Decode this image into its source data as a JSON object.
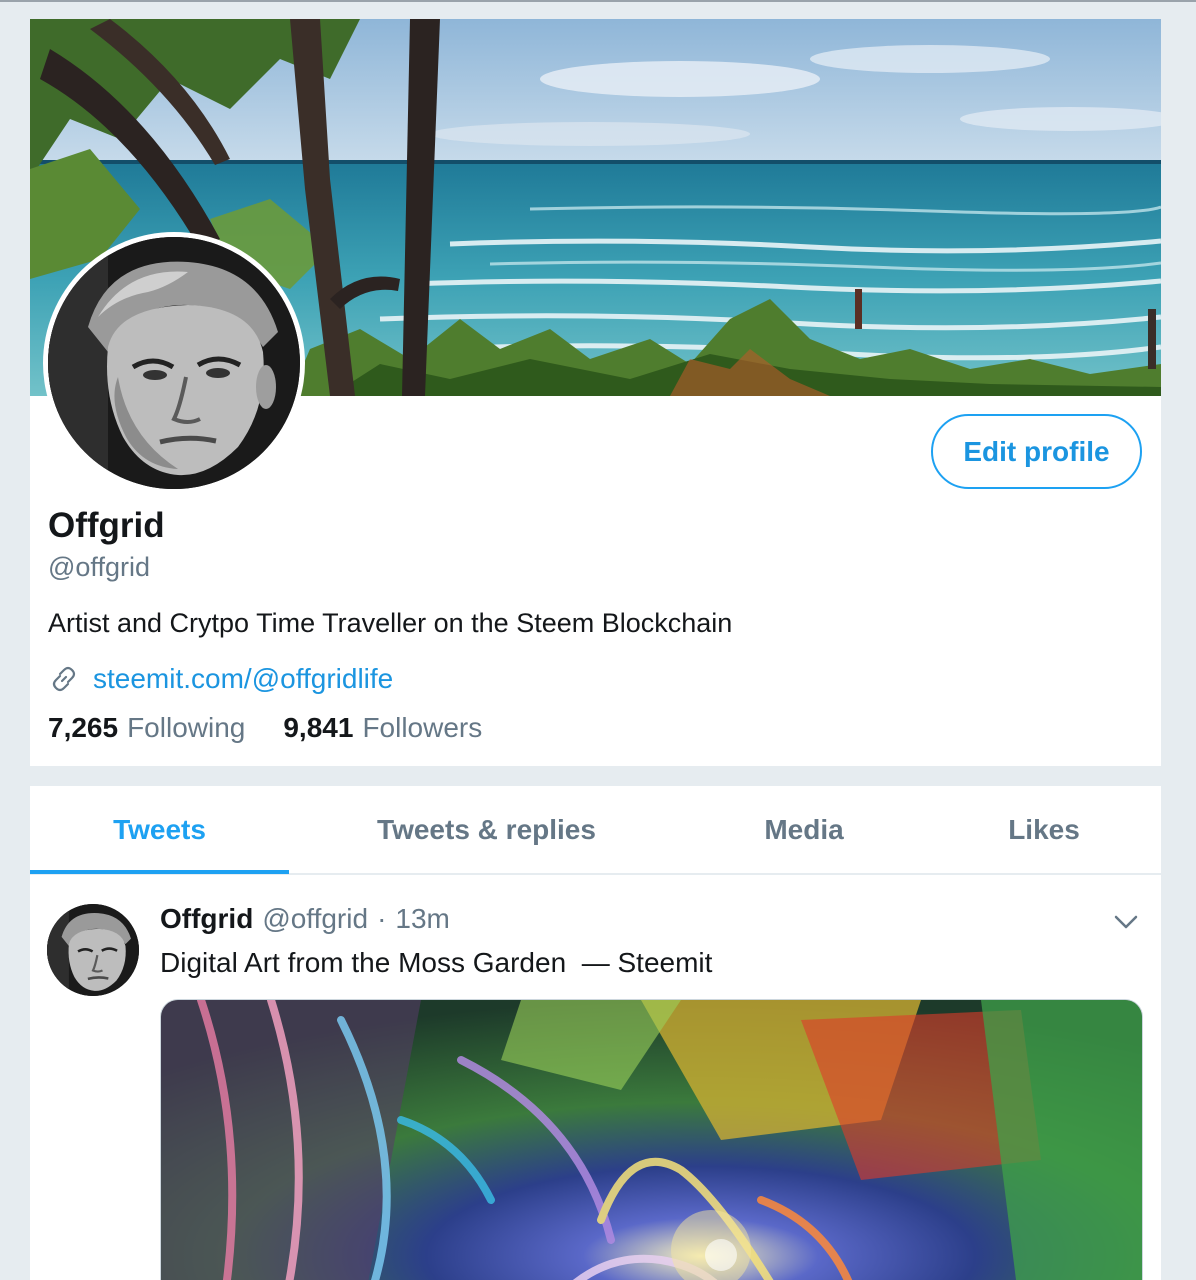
{
  "profile": {
    "display_name": "Offgrid",
    "handle": "@offgrid",
    "bio": "Artist and Crytpo Time Traveller on the Steem Blockchain",
    "website": "steemit.com/@offgridlife",
    "edit_button_label": "Edit profile",
    "following_count": "7,265",
    "following_label": "Following",
    "followers_count": "9,841",
    "followers_label": "Followers",
    "link_icon": "link-icon"
  },
  "tabs": [
    {
      "label": "Tweets",
      "active": true
    },
    {
      "label": "Tweets & replies",
      "active": false
    },
    {
      "label": "Media",
      "active": false
    },
    {
      "label": "Likes",
      "active": false
    }
  ],
  "tweet": {
    "author_name": "Offgrid",
    "author_handle": "@offgrid",
    "separator": "·",
    "time": "13m",
    "text": "Digital Art from the Moss Garden  — Steemit",
    "menu_icon": "chevron-down-icon"
  },
  "colors": {
    "accent": "#1da1f2",
    "link": "#1b95e0",
    "muted_text": "#657786",
    "page_background": "#e6ecf0"
  }
}
